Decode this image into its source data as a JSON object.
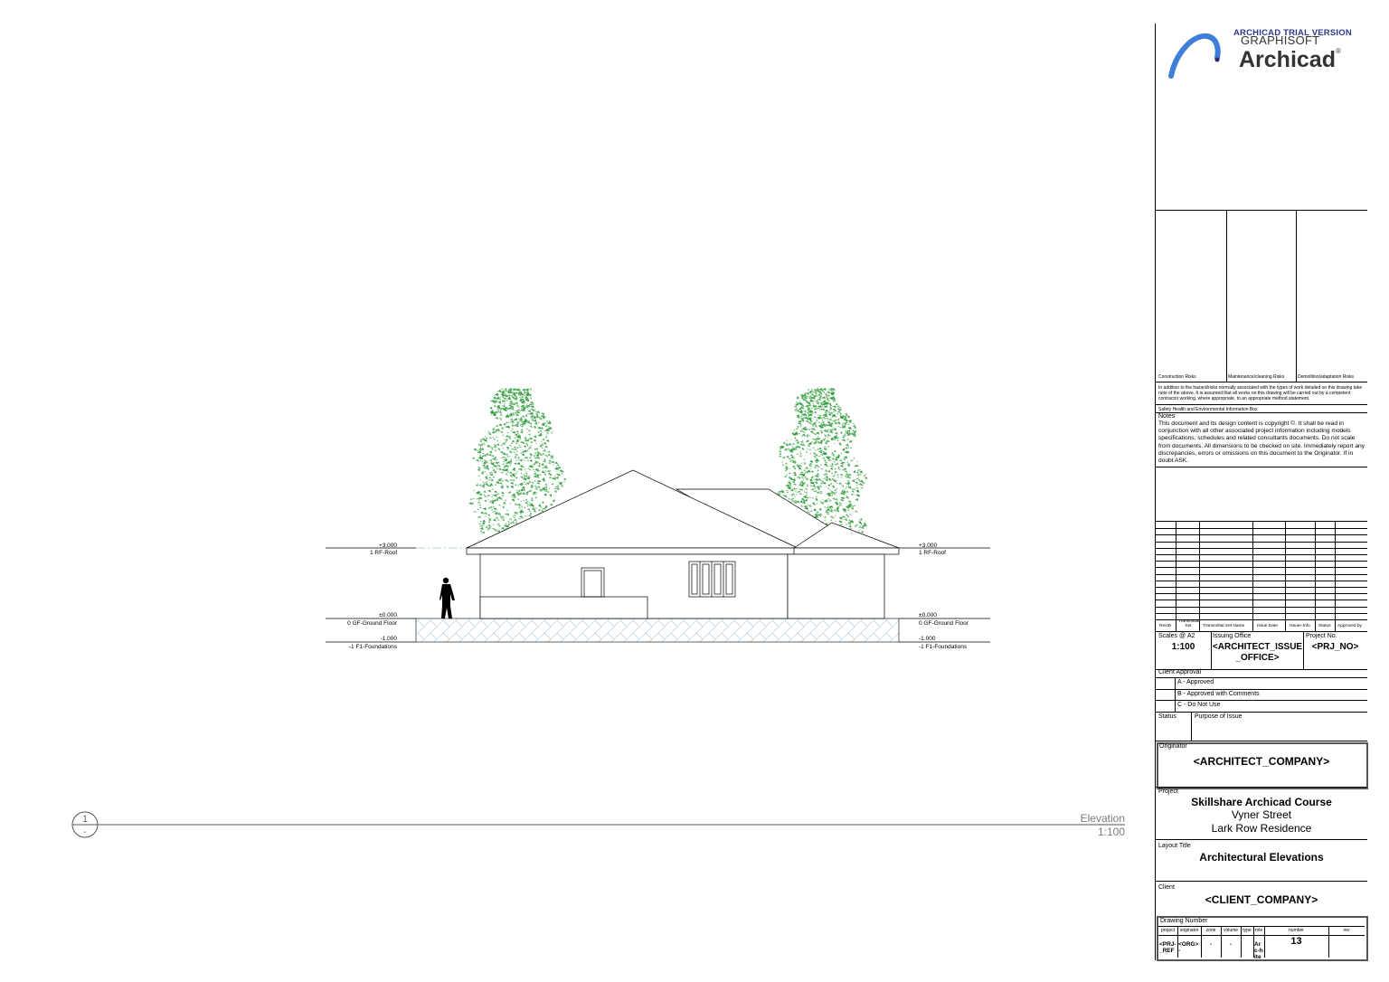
{
  "drawing": {
    "levels_left": [
      {
        "value": "+3.000",
        "name": "1 RF-Roof"
      },
      {
        "value": "±0.000",
        "name": "0 GF-Ground Floor"
      },
      {
        "value": "-1.000",
        "name": "-1 F1-Foundations"
      }
    ],
    "levels_right": [
      {
        "value": "+3.000",
        "name": "1 RF-Roof"
      },
      {
        "value": "±0.000",
        "name": "0 GF-Ground Floor"
      },
      {
        "value": "-1.000",
        "name": "-1 F1-Foundations"
      }
    ],
    "marker_number": "1",
    "marker_sheet": "-",
    "view_title": "Elevation",
    "view_scale": "1:100",
    "colors": {
      "tree": "#2e9a3a",
      "line": "#000000",
      "hatch": "#a8c8e0",
      "title_text": "#7a7a7a"
    }
  },
  "titleblock": {
    "watermark": "ARCHICAD TRIAL VERSION",
    "brand_top": "GRAPHISOFT",
    "brand_name": "Archicad",
    "brand_reg": "®",
    "risk_headers": [
      "Construction Risks",
      "Maintenance/cleaning Risks",
      "Demolition/adaptation Risks"
    ],
    "risk_note": "In addition to the hazard/risks normally associated with the types of work detailed on this drawing take note of the above. It is assumed that all works on this drawing will be carried out by a competent contractor working, where appropriate, to an appropriate method statement.",
    "safety_label": "Safety Health and Environmental Information Box",
    "notes_label": "Notes",
    "notes_text": "This document and its design content is copyright ©. It shall be read in conjunction with all other associated project information including models specifications, schedules and related consultants documents. Do not scale from documents. All dimensions to be checked on site. Immediately report any discrepancies, errors or omissions on this document to the Originator. If in doubt ASK.",
    "revision_headers": [
      "RevID",
      "Transmittal Set",
      "Transmittal Set Name",
      "Issue Date",
      "Issuer-Info",
      "Status",
      "Approved by"
    ],
    "scales_label": "Scales @",
    "paper": "A2",
    "scale_value": "1:100",
    "issuing_office_label": "Issuing Office",
    "issuing_office": "<ARCHITECT_ISSUE_OFFICE>",
    "project_no_label": "Project No.",
    "project_no": "<PRJ_NO>",
    "client_approval_label": "Client Approval",
    "approval_options": [
      "A - Approved",
      "B - Approved with Comments",
      "C - Do Not Use"
    ],
    "status_label": "Status",
    "purpose_label": "Purpose of Issue",
    "originator_label": "Originator",
    "originator": "<ARCHITECT_COMPANY>",
    "project_label": "Project",
    "project_name": "Skillshare Archicad Course",
    "project_street": "Vyner Street",
    "project_site": "Lark Row Residence",
    "layout_title_label": "Layout Title",
    "layout_title": "Architectural Elevations",
    "client_label": "Client",
    "client": "<CLIENT_COMPANY>",
    "drawing_number_label": "Drawing Number",
    "dn_headers": [
      "project",
      "originator",
      "zone",
      "volume",
      "type",
      "role",
      "number",
      "rev"
    ],
    "dn_values": [
      "<PRJ-_REF",
      "<ORG>-",
      "-",
      "-",
      "",
      "Arc-hite",
      "13",
      ""
    ]
  }
}
